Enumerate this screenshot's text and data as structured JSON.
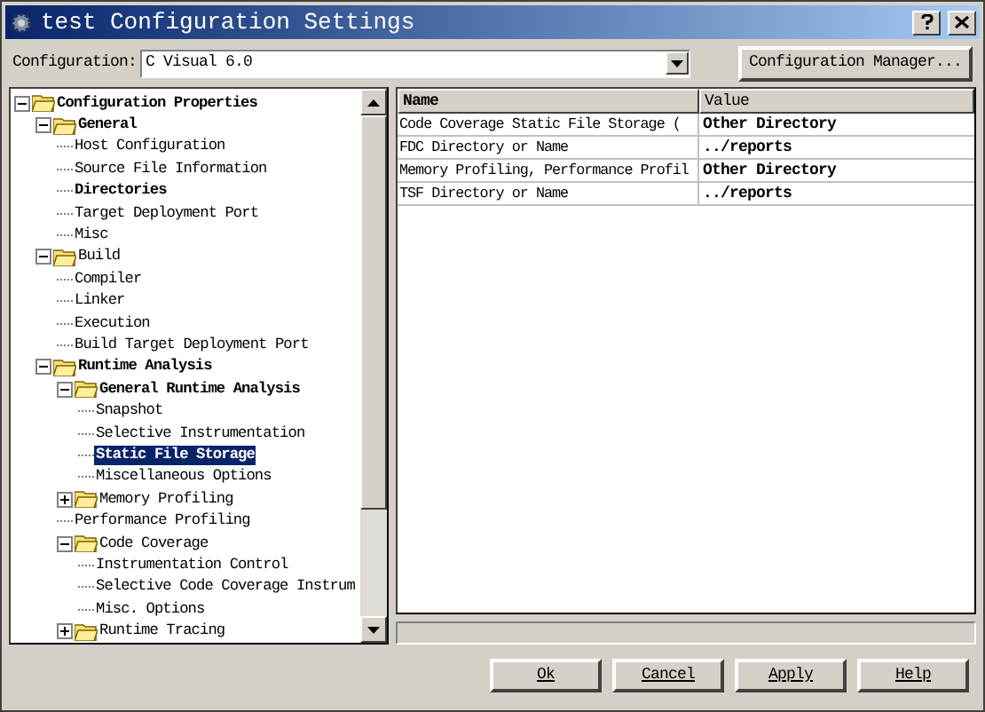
{
  "window": {
    "title": "test Configuration Settings"
  },
  "configuration": {
    "label": "Configuration:",
    "value": "C Visual 6.0"
  },
  "config_manager_button": "Configuration Manager...",
  "tree": [
    {
      "label": "Configuration Properties",
      "bold": true,
      "expanded": true,
      "selected": false,
      "children": [
        {
          "label": "General",
          "bold": true,
          "expanded": true,
          "selected": false,
          "children": [
            {
              "label": "Host Configuration",
              "bold": false,
              "selected": false
            },
            {
              "label": "Source File Information",
              "bold": false,
              "selected": false
            },
            {
              "label": "Directories",
              "bold": true,
              "selected": false
            },
            {
              "label": "Target Deployment Port",
              "bold": false,
              "selected": false
            },
            {
              "label": "Misc",
              "bold": false,
              "selected": false
            }
          ]
        },
        {
          "label": "Build",
          "bold": false,
          "expanded": true,
          "selected": false,
          "children": [
            {
              "label": "Compiler",
              "bold": false,
              "selected": false
            },
            {
              "label": "Linker",
              "bold": false,
              "selected": false
            },
            {
              "label": "Execution",
              "bold": false,
              "selected": false
            },
            {
              "label": "Build Target Deployment Port",
              "bold": false,
              "selected": false
            }
          ]
        },
        {
          "label": "Runtime Analysis",
          "bold": true,
          "expanded": true,
          "selected": false,
          "children": [
            {
              "label": "General Runtime Analysis",
              "bold": true,
              "expanded": true,
              "selected": false,
              "children": [
                {
                  "label": "Snapshot",
                  "bold": false,
                  "selected": false
                },
                {
                  "label": "Selective Instrumentation",
                  "bold": false,
                  "selected": false
                },
                {
                  "label": "Static File Storage",
                  "bold": true,
                  "selected": true
                },
                {
                  "label": "Miscellaneous Options",
                  "bold": false,
                  "selected": false
                }
              ]
            },
            {
              "label": "Memory Profiling",
              "bold": false,
              "expanded": false,
              "selected": false
            },
            {
              "label": "Performance Profiling",
              "bold": false,
              "selected": false
            },
            {
              "label": "Code Coverage",
              "bold": false,
              "expanded": true,
              "selected": false,
              "children": [
                {
                  "label": "Instrumentation Control",
                  "bold": false,
                  "selected": false
                },
                {
                  "label": "Selective Code Coverage Instrum",
                  "bold": false,
                  "selected": false
                },
                {
                  "label": "Misc. Options",
                  "bold": false,
                  "selected": false
                }
              ]
            },
            {
              "label": "Runtime Tracing",
              "bold": false,
              "expanded": false,
              "selected": false
            }
          ]
        }
      ]
    }
  ],
  "table": {
    "columns": [
      "Name",
      "Value"
    ],
    "rows": [
      {
        "name": "Code Coverage Static File Storage (",
        "value": "Other Directory"
      },
      {
        "name": "FDC Directory or Name",
        "value": "../reports"
      },
      {
        "name": "Memory Profiling, Performance Profil",
        "value": "Other Directory"
      },
      {
        "name": "TSF Directory or Name",
        "value": "../reports"
      }
    ]
  },
  "buttons": [
    "Ok",
    "Cancel",
    "Apply",
    "Help"
  ]
}
